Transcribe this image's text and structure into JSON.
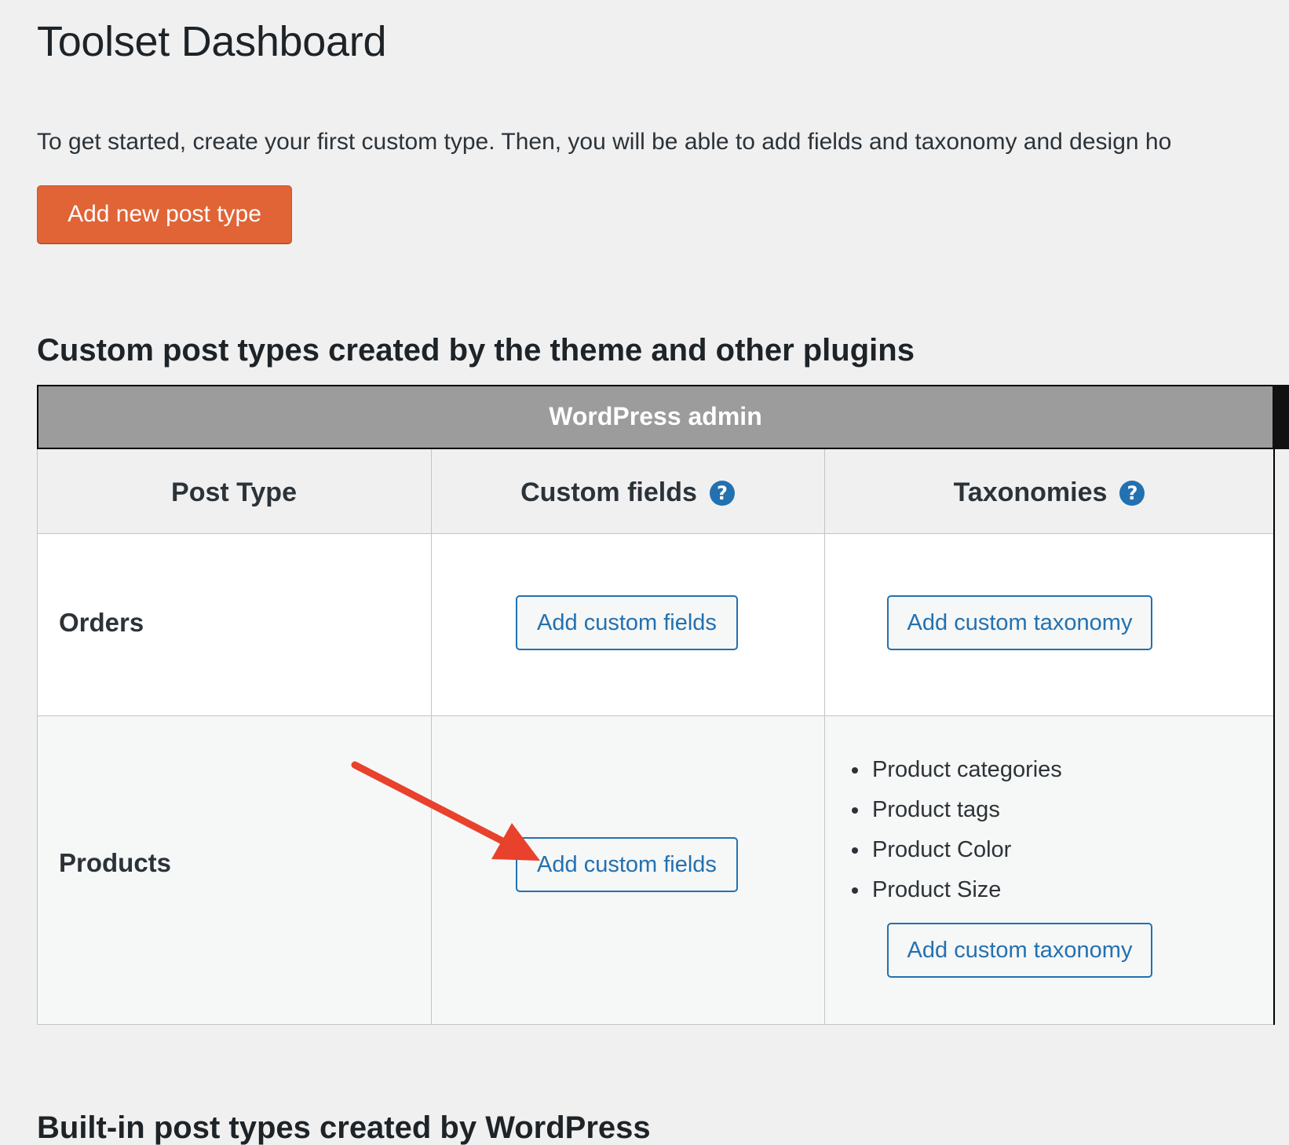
{
  "page": {
    "title": "Toolset Dashboard",
    "intro": "To get started, create your first custom type. Then, you will be able to add fields and taxonomy and design ho",
    "add_post_type_label": "Add new post type"
  },
  "section_custom": {
    "heading": "Custom post types created by the theme and other plugins",
    "group_header": "WordPress admin",
    "columns": {
      "post_type": "Post Type",
      "custom_fields": "Custom fields",
      "taxonomies": "Taxonomies",
      "help_glyph": "?"
    },
    "rows": [
      {
        "name": "Orders",
        "custom_fields_button": "Add custom fields",
        "taxonomies": [],
        "taxonomy_button": "Add custom taxonomy"
      },
      {
        "name": "Products",
        "custom_fields_button": "Add custom fields",
        "taxonomies": [
          "Product categories",
          "Product tags",
          "Product Color",
          "Product Size"
        ],
        "taxonomy_button": "Add custom taxonomy"
      }
    ]
  },
  "section_builtin": {
    "heading": "Built-in post types created by WordPress"
  },
  "colors": {
    "background": "#f0f0f1",
    "primary_button": "#e06436",
    "link_blue": "#2271b1",
    "annotation_arrow": "#e8412c",
    "group_header_bg": "#9c9c9c"
  },
  "icons": {
    "help": "help-circle-icon",
    "annotation": "arrow-annotation-icon"
  }
}
